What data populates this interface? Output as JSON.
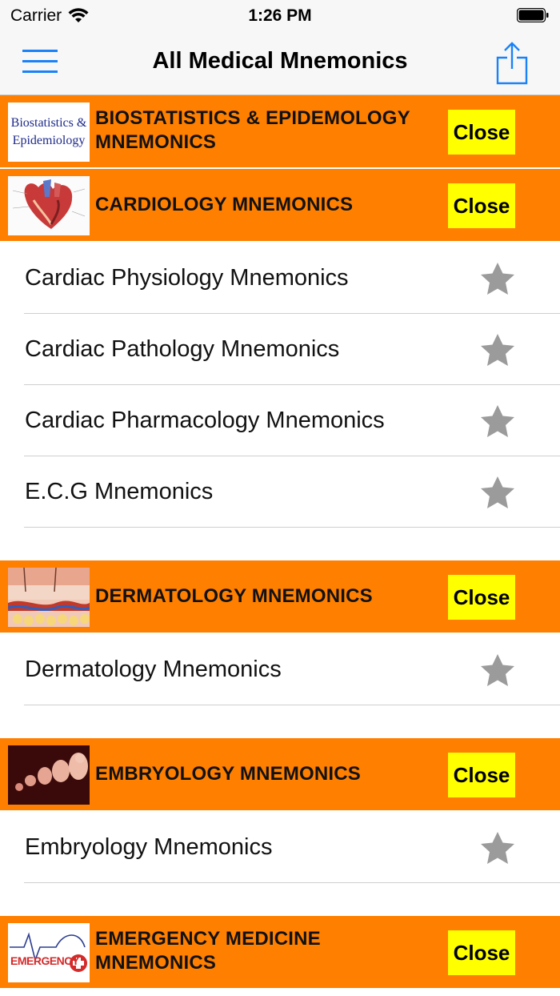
{
  "status_bar": {
    "carrier": "Carrier",
    "time": "1:26 PM"
  },
  "nav": {
    "title": "All Medical Mnemonics"
  },
  "colors": {
    "section_bg": "#ff7f00",
    "close_bg": "#ffff00",
    "star": "#9b9b9b",
    "accent": "#1a82f7"
  },
  "sections": [
    {
      "title": "BIOSTATISTICS & EPIDEMOLOGY MNEMONICS",
      "thumb_text": [
        "Biostatistics &",
        "Epidemiology"
      ],
      "close_label": "Close",
      "items": []
    },
    {
      "title": "CARDIOLOGY MNEMONICS",
      "close_label": "Close",
      "items": [
        {
          "label": "Cardiac Physiology Mnemonics",
          "icon": "star-icon"
        },
        {
          "label": "Cardiac Pathology Mnemonics",
          "icon": "star-icon"
        },
        {
          "label": "Cardiac Pharmacology Mnemonics",
          "icon": "star-icon"
        },
        {
          "label": "E.C.G Mnemonics",
          "icon": "star-icon"
        }
      ]
    },
    {
      "title": "DERMATOLOGY MNEMONICS",
      "close_label": "Close",
      "items": [
        {
          "label": "Dermatology Mnemonics",
          "icon": "star-icon"
        }
      ]
    },
    {
      "title": "EMBRYOLOGY MNEMONICS",
      "close_label": "Close",
      "items": [
        {
          "label": "Embryology Mnemonics",
          "icon": "star-icon"
        }
      ]
    },
    {
      "title": "EMERGENCY MEDICINE MNEMONICS",
      "thumb_text": [
        "EMERGENCY"
      ],
      "close_label": "Close",
      "items": []
    }
  ]
}
